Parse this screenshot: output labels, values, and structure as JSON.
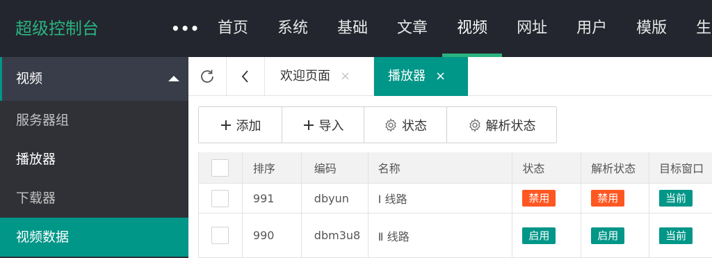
{
  "header": {
    "logo": "超级控制台",
    "more": "•••",
    "nav": [
      "首页",
      "系统",
      "基础",
      "文章",
      "视频",
      "网址",
      "用户",
      "模版",
      "生成"
    ],
    "active_nav": "视频"
  },
  "sidebar": {
    "section": "视频",
    "items": [
      {
        "label": "服务器组"
      },
      {
        "label": "播放器"
      },
      {
        "label": "下载器"
      },
      {
        "label": "视频数据"
      }
    ]
  },
  "tabs": {
    "items": [
      {
        "label": "欢迎页面",
        "close": "×"
      },
      {
        "label": "播放器",
        "close": "×"
      }
    ],
    "active": "播放器"
  },
  "toolbar": {
    "add": "添加",
    "import": "导入",
    "status": "状态",
    "parse_status": "解析状态"
  },
  "table": {
    "columns": [
      "排序",
      "编码",
      "名称",
      "状态",
      "解析状态",
      "目标窗口"
    ],
    "rows": [
      {
        "sort": "991",
        "code": "dbyun",
        "name": "Ⅰ 线路",
        "status": "禁用",
        "parse": "禁用",
        "target": "当前"
      },
      {
        "sort": "990",
        "code": "dbm3u8",
        "name": "Ⅱ 线路",
        "status": "启用",
        "parse": "启用",
        "target": "当前"
      }
    ]
  },
  "colors": {
    "brand": "#2ab37f",
    "accent": "#009688",
    "danger": "#ff5722",
    "header_bg": "#23262e",
    "sidebar_bg": "#2f3137"
  }
}
